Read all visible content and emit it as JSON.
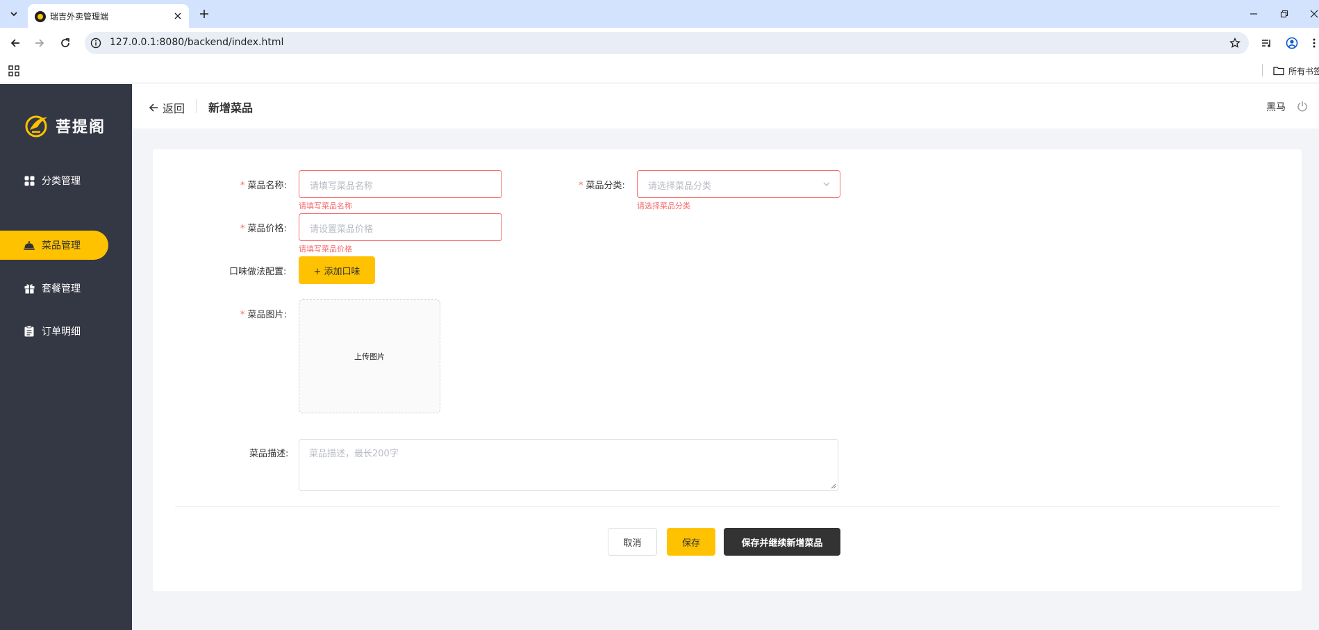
{
  "browser": {
    "tab_title": "瑞吉外卖管理端",
    "url": "127.0.0.1:8080/backend/index.html",
    "bookmark_folder": "所有书签"
  },
  "sidebar": {
    "logo_text": "菩提阁",
    "items": [
      {
        "label": "分类管理",
        "icon": "category-grid-icon",
        "active": false
      },
      {
        "label": "菜品管理",
        "icon": "dish-cloche-icon",
        "active": true
      },
      {
        "label": "套餐管理",
        "icon": "gift-package-icon",
        "active": false
      },
      {
        "label": "订单明细",
        "icon": "clipboard-order-icon",
        "active": false
      }
    ]
  },
  "header": {
    "back_label": "返回",
    "title": "新增菜品",
    "username": "黑马"
  },
  "form": {
    "name": {
      "label": "菜品名称:",
      "placeholder": "请填写菜品名称",
      "error": "请填写菜品名称"
    },
    "category": {
      "label": "菜品分类:",
      "placeholder": "请选择菜品分类",
      "error": "请选择菜品分类"
    },
    "price": {
      "label": "菜品价格:",
      "placeholder": "请设置菜品价格",
      "error": "请填写菜品价格"
    },
    "flavor": {
      "label": "口味做法配置:",
      "button": "+ 添加口味"
    },
    "image": {
      "label": "菜品图片:",
      "upload_text": "上传图片"
    },
    "description": {
      "label": "菜品描述:",
      "placeholder": "菜品描述，最长200字"
    }
  },
  "actions": {
    "cancel": "取消",
    "save": "保存",
    "save_continue": "保存并继续新增菜品"
  },
  "colors": {
    "sidebar_bg": "#343744",
    "accent": "#ffc200",
    "error": "#f56c6c",
    "dark_button": "#333333"
  }
}
